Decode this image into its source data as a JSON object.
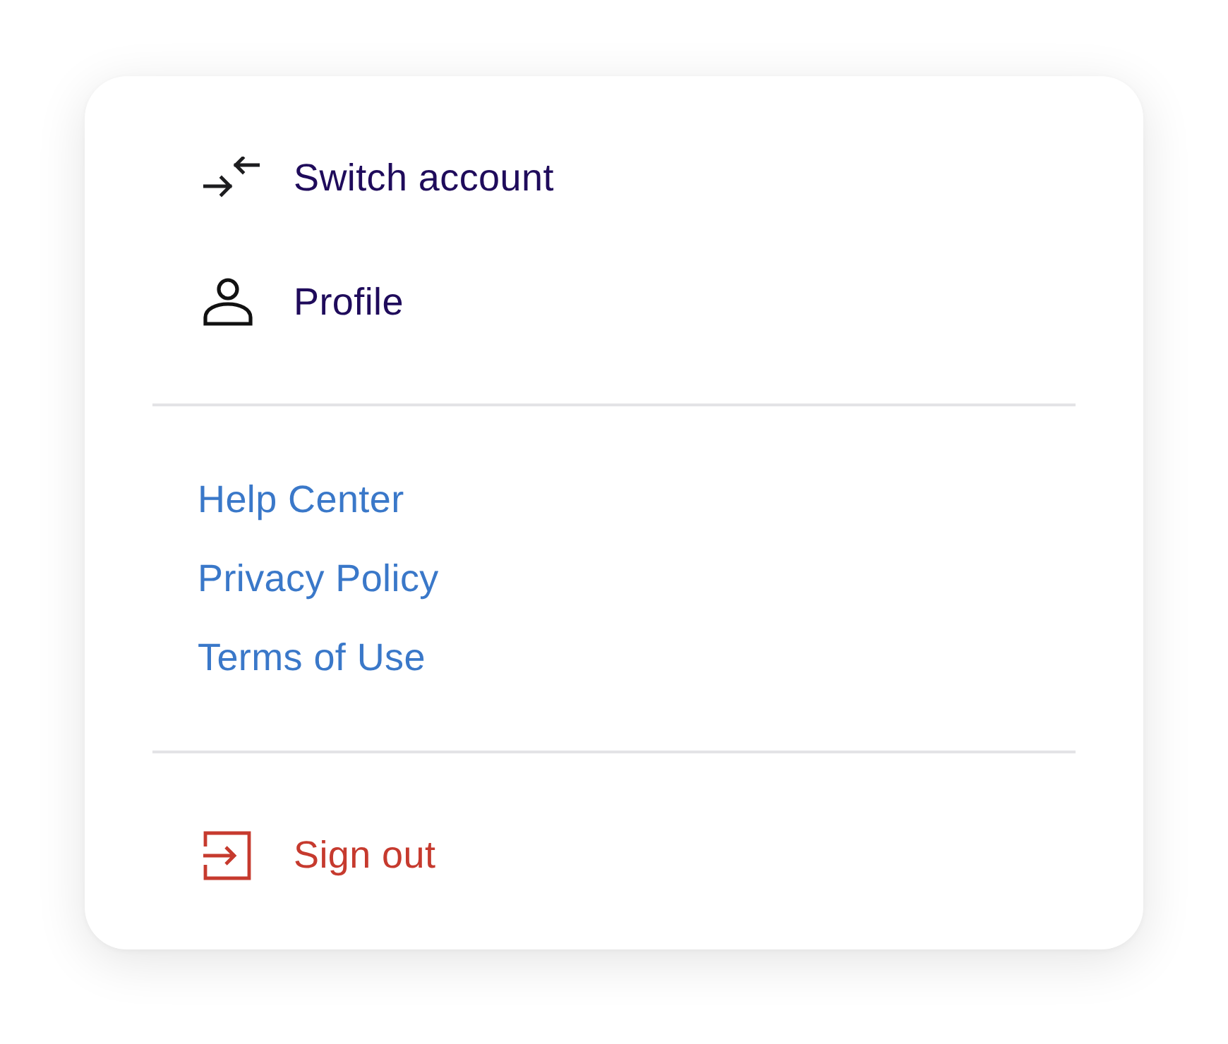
{
  "menu_items": [
    {
      "kind": "switch",
      "label": "Switch account"
    },
    {
      "kind": "profile",
      "label": "Profile"
    }
  ],
  "links": [
    {
      "label": "Help Center"
    },
    {
      "label": "Privacy Policy"
    },
    {
      "label": "Terms of Use"
    }
  ],
  "sign_out": {
    "label": "Sign out"
  }
}
